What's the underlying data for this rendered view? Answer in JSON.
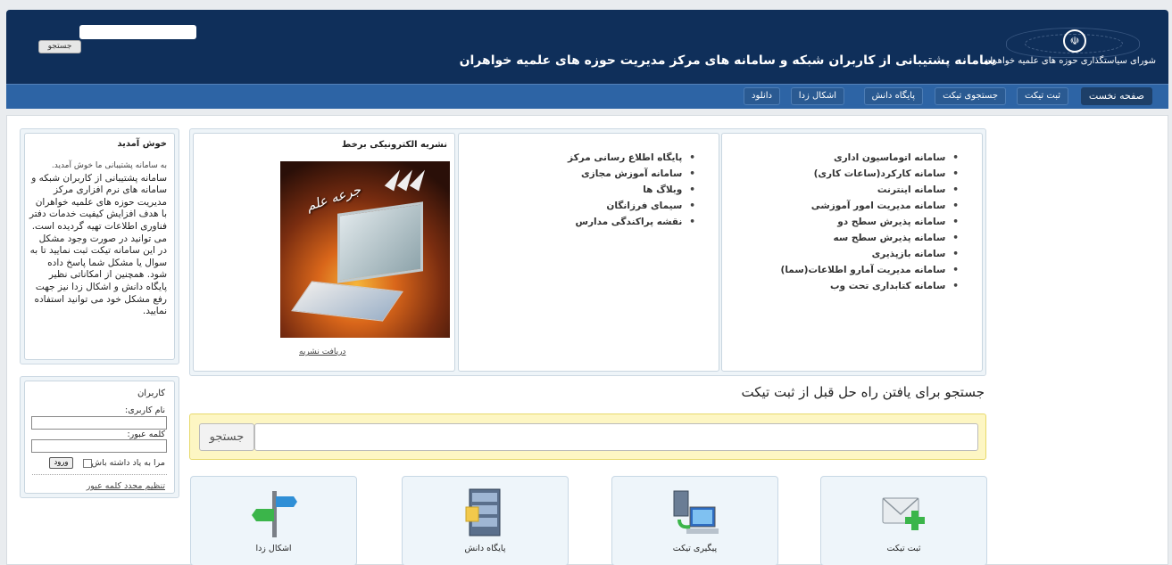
{
  "header": {
    "site_title": "سامانه پشتیبانی از کاربران شبکه و سامانه های مرکز مدیریت حوزه های علمیه خواهران",
    "council_name": "شورای سیاستگذاری حوزه های علمیه خواهران",
    "search_button": "جستجو",
    "search_value": ""
  },
  "nav": {
    "items": [
      {
        "label": "صفحه نخست",
        "active": true
      },
      {
        "label": "ثبت تیکت",
        "active": false
      },
      {
        "label": "جستجوی تیکت",
        "active": false
      },
      {
        "label": "پایگاه دانش",
        "active": false
      },
      {
        "label": "اشکال زدا",
        "active": false
      },
      {
        "label": "دانلود",
        "active": false
      }
    ]
  },
  "systems_col1": [
    "سامانه اتوماسیون اداری",
    "سامانه کارکرد(ساعات کاری)",
    "سامانه اینترنت",
    "سامانه مدیریت امور آموزشی",
    "سامانه پذیرش سطح دو",
    "سامانه پذیرش سطح سه",
    "سامانه بازپذیری",
    "سامانه مدیریت آمارو اطلاعات(سما)",
    "سامانه کتابداری تحت وب"
  ],
  "systems_col2": [
    "پایگاه اطلاع رسانی مرکز",
    "سامانه آموزش مجازی",
    "وبلاگ ها",
    "سیمای فرزانگان",
    "نقشه پراکندگی مدارس"
  ],
  "magazine": {
    "title": "نشریه الکترونیکی برخط",
    "cover_text": "جرعه علم",
    "download_link": "دریافت نشریه"
  },
  "welcome": {
    "title": "خوش آمدید",
    "intro": "به سامانه پشتیبانی ما خوش آمدید.",
    "body": "سامانه پشتیبانی از کاربران شبکه و سامانه های نرم افزاری مرکز مدیریت حوزه های علمیه خواهران با هدف افزایش کیفیت خدمات دفتر فناوری اطلاعات تهیه گردیده است. می توانید در صورت وجود مشکل در این سامانه تیکت ثبت نمایید تا به سوال یا مشکل شما پاسخ داده شود. همچنین از امکاناتی نظیر پایگاه دانش و اشکال زدا نیز جهت رفع مشکل خود می توانید استفاده نمایید."
  },
  "users": {
    "title": "کاربران",
    "username_label": "نام کاربری:",
    "password_label": "کلمه عبور:",
    "remember_label": "مرا به یاد داشته باش",
    "login_button": "ورود",
    "reset_link": "تنظیم مجدد کلمه عبور"
  },
  "search": {
    "heading": "جستجو برای یافتن راه حل قبل از ثبت تیکت",
    "button": "جستجو",
    "value": ""
  },
  "tiles": [
    {
      "label": "ثبت تیکت",
      "icon": "mail-add-icon"
    },
    {
      "label": "پیگیری تیکت",
      "icon": "computer-sync-icon"
    },
    {
      "label": "پایگاه دانش",
      "icon": "file-cabinet-icon"
    },
    {
      "label": "اشکال زدا",
      "icon": "signpost-icon"
    }
  ]
}
